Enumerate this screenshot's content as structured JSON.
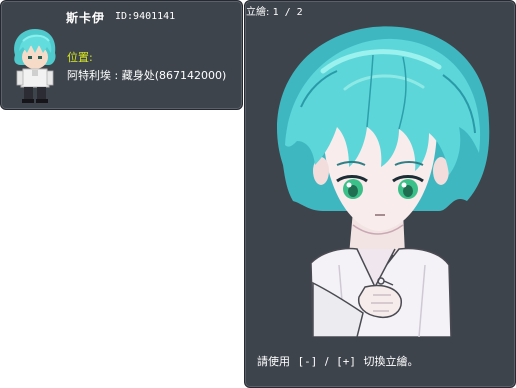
{
  "npc": {
    "name": "斯卡伊",
    "id_text": "ID:9401141",
    "location_label": "位置:",
    "location_value": "阿特利埃 : 藏身处(867142000)"
  },
  "portrait": {
    "counter_label": "立繪:",
    "counter_value": "1 / 2",
    "hint_prefix": "請使用",
    "prev_key": "[-]",
    "separator": "/",
    "next_key": "[+]",
    "hint_suffix": "切換立繪。"
  },
  "colors": {
    "panel_bg": "#3e444c",
    "location_label": "#d8e820",
    "text": "#ffffff",
    "hair": "#5fd6d6",
    "eyes": "#3cc08a"
  },
  "icons": {
    "avatar": "npc-sprite-icon",
    "portrait": "npc-portrait"
  }
}
